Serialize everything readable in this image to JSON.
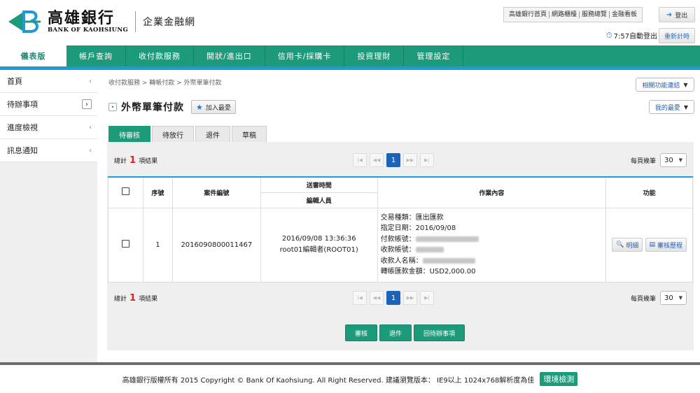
{
  "header": {
    "logo_cn": "高雄銀行",
    "logo_en": "BANK OF KAOHSIUNG",
    "portal_name": "企業金融網",
    "top_links": [
      "高雄銀行首頁",
      "網路櫃檯",
      "服務總覽",
      "金融看板"
    ],
    "logout_label": "登出",
    "timer_text": "7:57自動登出",
    "reset_label": "重新計時"
  },
  "nav": {
    "items": [
      "儀表版",
      "帳戶查詢",
      "收付款服務",
      "開狀/進出口",
      "信用卡/採購卡",
      "投資理財",
      "管理設定"
    ]
  },
  "sidebar": {
    "items": [
      "首頁",
      "待辦事項",
      "進度檢視",
      "訊息通知"
    ]
  },
  "main": {
    "breadcrumb": "收付款服務 > 轉帳付款 > 外幣單筆付款",
    "title": "外幣單筆付款",
    "add_fav_label": "加入最愛",
    "related_label": "相關功能連結",
    "my_fav_label": "我的最愛",
    "tabs": [
      "待審核",
      "待放行",
      "退件",
      "草稿"
    ]
  },
  "pager": {
    "total_prefix": "總計",
    "total_count": "1",
    "total_suffix": "項結果",
    "current_page": "1",
    "per_page_label": "每頁幾筆",
    "per_page_value": "30"
  },
  "table": {
    "headers": {
      "seq": "序號",
      "case_no": "案件編號",
      "send_time": "送審時間",
      "editor": "編輯人員",
      "content": "作業內容",
      "function": "功能"
    },
    "rows": [
      {
        "seq": "1",
        "case_no": "2016090800011467",
        "send_time": "2016/09/08 13:36:36",
        "editor": "root01編輯者(ROOT01)",
        "content": {
          "type": "交易種類：匯出匯款",
          "date": "指定日期：2016/09/08",
          "pay_account": "付款帳號：",
          "recv_account": "收款帳號：",
          "recv_name": "收款人名稱：",
          "amount": "轉帳匯款金額：USD2,000.00"
        },
        "detail_label": "明細",
        "history_label": "審核歷程"
      }
    ]
  },
  "actions": {
    "approve": "審核",
    "reject": "退件",
    "back": "回待辦事項"
  },
  "footer": {
    "text": "高雄銀行版權所有 2015 Copyright © Bank Of Kaohsiung. All Right Reserved. 建議瀏覽版本： IE9以上 1024x768解析度為佳",
    "env_label": "環境檢測"
  },
  "colors": {
    "brand_green": "#1d9a7a",
    "accent_blue": "#1e9ad6",
    "highlight_red": "#dd2222"
  }
}
